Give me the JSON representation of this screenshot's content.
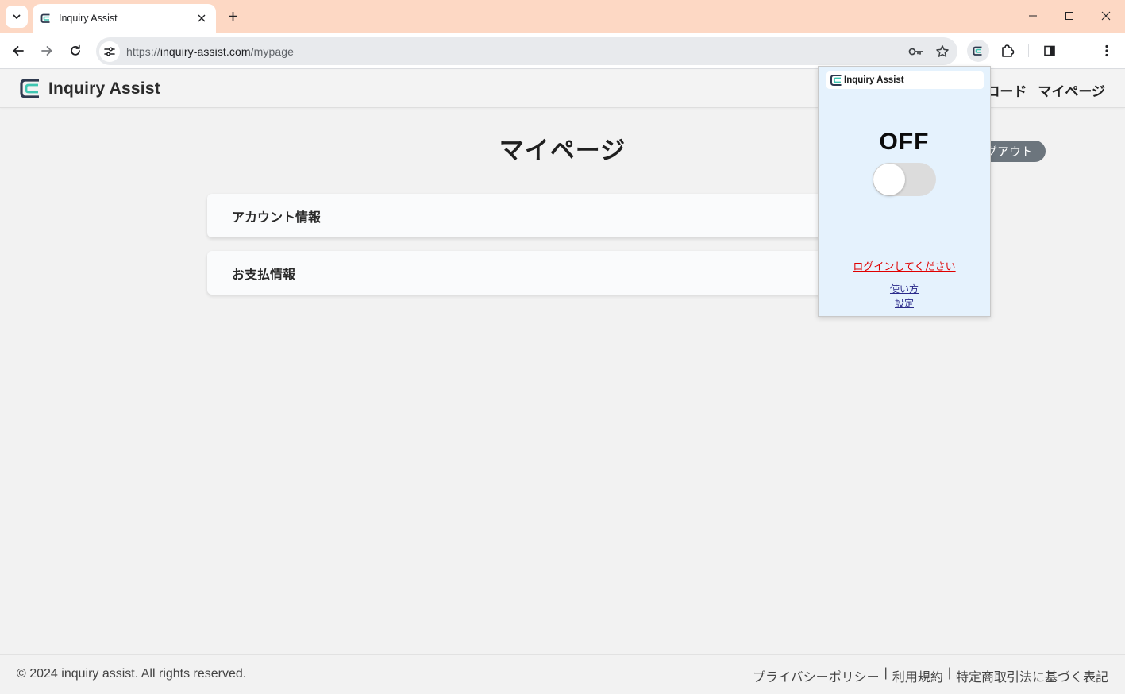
{
  "browser": {
    "tab_title": "Inquiry Assist",
    "url_scheme": "https://",
    "url_host": "inquiry-assist.com",
    "url_path": "/mypage"
  },
  "site": {
    "brand": "Inquiry Assist",
    "nav": {
      "download_partial": "ンロード",
      "mypage": "マイページ"
    },
    "page_title": "マイページ",
    "logout_partial": "グアウト",
    "cards": [
      {
        "label": "アカウント情報"
      },
      {
        "label": "お支払情報"
      }
    ],
    "footer": {
      "copyright": "© 2024 inquiry assist. All rights reserved.",
      "privacy": "プライバシーポリシー",
      "sep1": "|",
      "terms": "利用規約",
      "sep2": "|",
      "commerce": "特定商取引法に基づく表記"
    }
  },
  "popup": {
    "brand": "Inquiry Assist",
    "status": "OFF",
    "toggle_on": false,
    "login_link": "ログインしてください",
    "usage_link": "使い方",
    "settings_link": "設定"
  },
  "colors": {
    "tabstrip": "#fdd8c4",
    "popup_bg": "#e5f2fd",
    "login_link": "#e00000",
    "logout_button": "#6c757d"
  },
  "icons": {
    "tab_menu": "chevron-down-icon",
    "tab_close": "close-icon",
    "new_tab": "plus-icon",
    "back": "arrow-left-icon",
    "forward": "arrow-right-icon",
    "reload": "reload-icon",
    "site_info": "tune-icon",
    "password": "key-icon",
    "bookmark": "star-icon",
    "extension": "inquiry-assist-logo-icon",
    "extensions_menu": "puzzle-icon",
    "side_panel": "side-panel-icon",
    "menu": "kebab-menu-icon",
    "minimize": "minimize-icon",
    "maximize": "maximize-icon",
    "close_window": "close-window-icon"
  }
}
